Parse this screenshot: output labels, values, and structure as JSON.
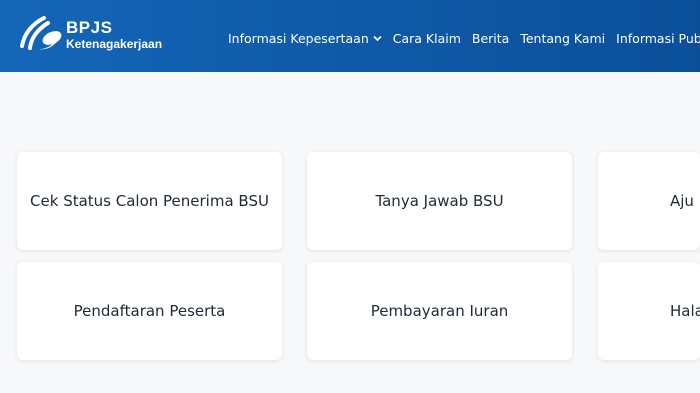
{
  "header": {
    "brand_name": "BPJS",
    "brand_sub": "Ketenagakerjaan",
    "nav": [
      {
        "label": "Informasi Kepesertaan",
        "has_dropdown": true
      },
      {
        "label": "Cara Klaim",
        "has_dropdown": false
      },
      {
        "label": "Berita",
        "has_dropdown": false
      },
      {
        "label": "Tentang Kami",
        "has_dropdown": false
      },
      {
        "label": "Informasi Publik",
        "has_dropdown": true
      }
    ]
  },
  "cards": [
    {
      "label": "Cek Status Calon Penerima BSU"
    },
    {
      "label": "Tanya Jawab BSU"
    },
    {
      "label": "Aju"
    },
    {
      "label": "Pendaftaran Peserta"
    },
    {
      "label": "Pembayaran Iuran"
    },
    {
      "label": "Hala"
    }
  ],
  "colors": {
    "header_start": "#1566b8",
    "header_end": "#0b4f99",
    "card_text": "#1f2937"
  }
}
